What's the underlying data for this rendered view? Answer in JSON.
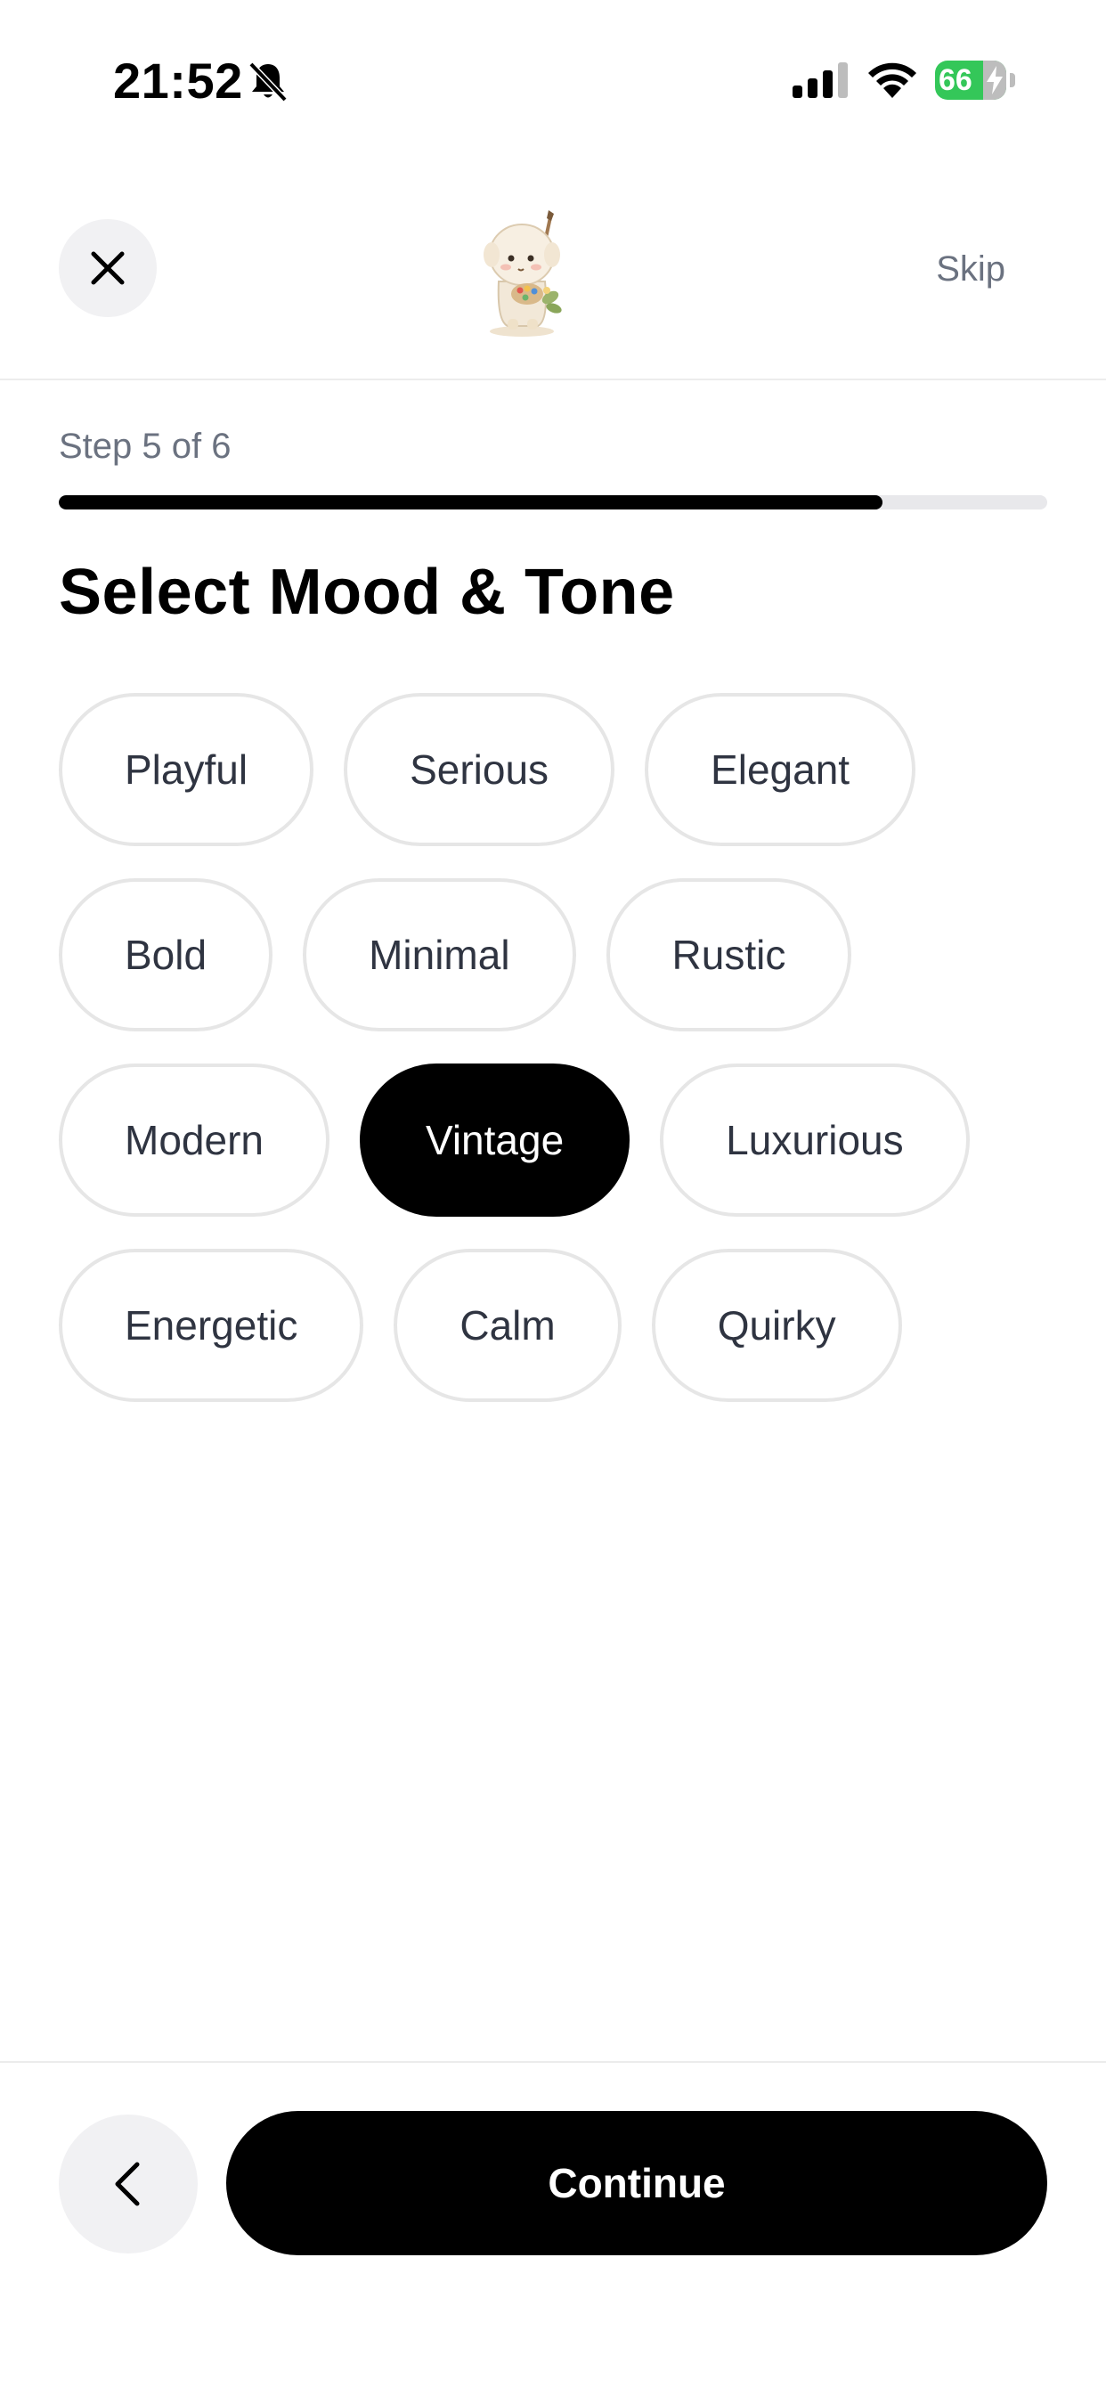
{
  "status_bar": {
    "time": "21:52",
    "battery_level": "66",
    "icons": [
      "bell-slash-icon",
      "cellular-signal-icon",
      "wifi-icon",
      "battery-charging-icon"
    ]
  },
  "header": {
    "close_icon": "close-icon",
    "mascot": "mascot-illustration",
    "skip_label": "Skip"
  },
  "progress": {
    "step_label": "Step 5 of 6",
    "fraction": 0.833
  },
  "title": "Select Mood & Tone",
  "chips": [
    [
      {
        "label": "Playful",
        "selected": false
      },
      {
        "label": "Serious",
        "selected": false
      },
      {
        "label": "Elegant",
        "selected": false
      }
    ],
    [
      {
        "label": "Bold",
        "selected": false
      },
      {
        "label": "Minimal",
        "selected": false
      },
      {
        "label": "Rustic",
        "selected": false
      }
    ],
    [
      {
        "label": "Modern",
        "selected": false
      },
      {
        "label": "Vintage",
        "selected": true
      },
      {
        "label": "Luxurious",
        "selected": false
      }
    ],
    [
      {
        "label": "Energetic",
        "selected": false
      },
      {
        "label": "Calm",
        "selected": false
      },
      {
        "label": "Quirky",
        "selected": false
      }
    ]
  ],
  "footer": {
    "back_icon": "chevron-left-icon",
    "continue_label": "Continue"
  },
  "colors": {
    "accent": "#000000",
    "muted_text": "#6b7280",
    "chip_text": "#2f3441",
    "chip_border": "#e6e6e6",
    "battery": "#34c759"
  }
}
